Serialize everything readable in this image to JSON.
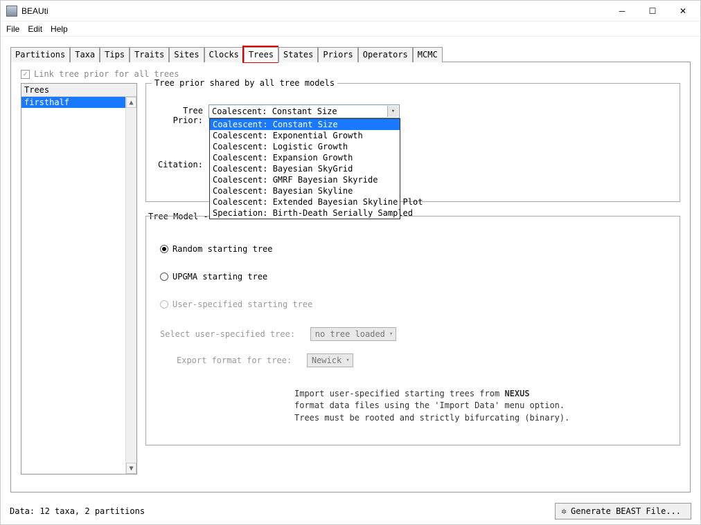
{
  "window": {
    "title": "BEAUti"
  },
  "menus": [
    "File",
    "Edit",
    "Help"
  ],
  "tabs": [
    "Partitions",
    "Taxa",
    "Tips",
    "Traits",
    "Sites",
    "Clocks",
    "Trees",
    "States",
    "Priors",
    "Operators",
    "MCMC"
  ],
  "active_tab": "Trees",
  "link_checkbox_label": "Link tree prior for all trees",
  "left": {
    "header": "Trees",
    "items": [
      "firsthalf"
    ],
    "selected": 0
  },
  "prior_section": {
    "legend": "Tree prior shared by all tree models",
    "tree_prior_label": "Tree Prior:",
    "tree_prior_value": "Coalescent: Constant Size",
    "citation_label": "Citation:",
    "options": [
      "Coalescent: Constant Size",
      "Coalescent: Exponential Growth",
      "Coalescent: Logistic Growth",
      "Coalescent: Expansion Growth",
      "Coalescent: Bayesian SkyGrid",
      "Coalescent: GMRF Bayesian Skyride",
      "Coalescent: Bayesian Skyline",
      "Coalescent: Extended Bayesian Skyline Plot",
      "Speciation: Birth-Death Serially Sampled"
    ],
    "selected_option": 0
  },
  "model_section": {
    "legend_prefix": "Tree Model - f",
    "radios": {
      "random": "Random starting tree",
      "upgma": "UPGMA starting tree",
      "user": "User-specified starting tree"
    },
    "selected_radio": "random",
    "select_tree_label": "Select user-specified tree:",
    "select_tree_value": "no tree loaded",
    "export_label": "Export format for tree:",
    "export_value": "Newick",
    "help_line1_prefix": "Import user-specified starting trees from ",
    "help_line1_bold": "NEXUS",
    "help_line2": "format data files using the 'Import Data' menu option.",
    "help_line3": "Trees must be rooted and strictly bifurcating (binary)."
  },
  "status": "Data: 12 taxa, 2 partitions",
  "generate_button": "Generate BEAST File..."
}
